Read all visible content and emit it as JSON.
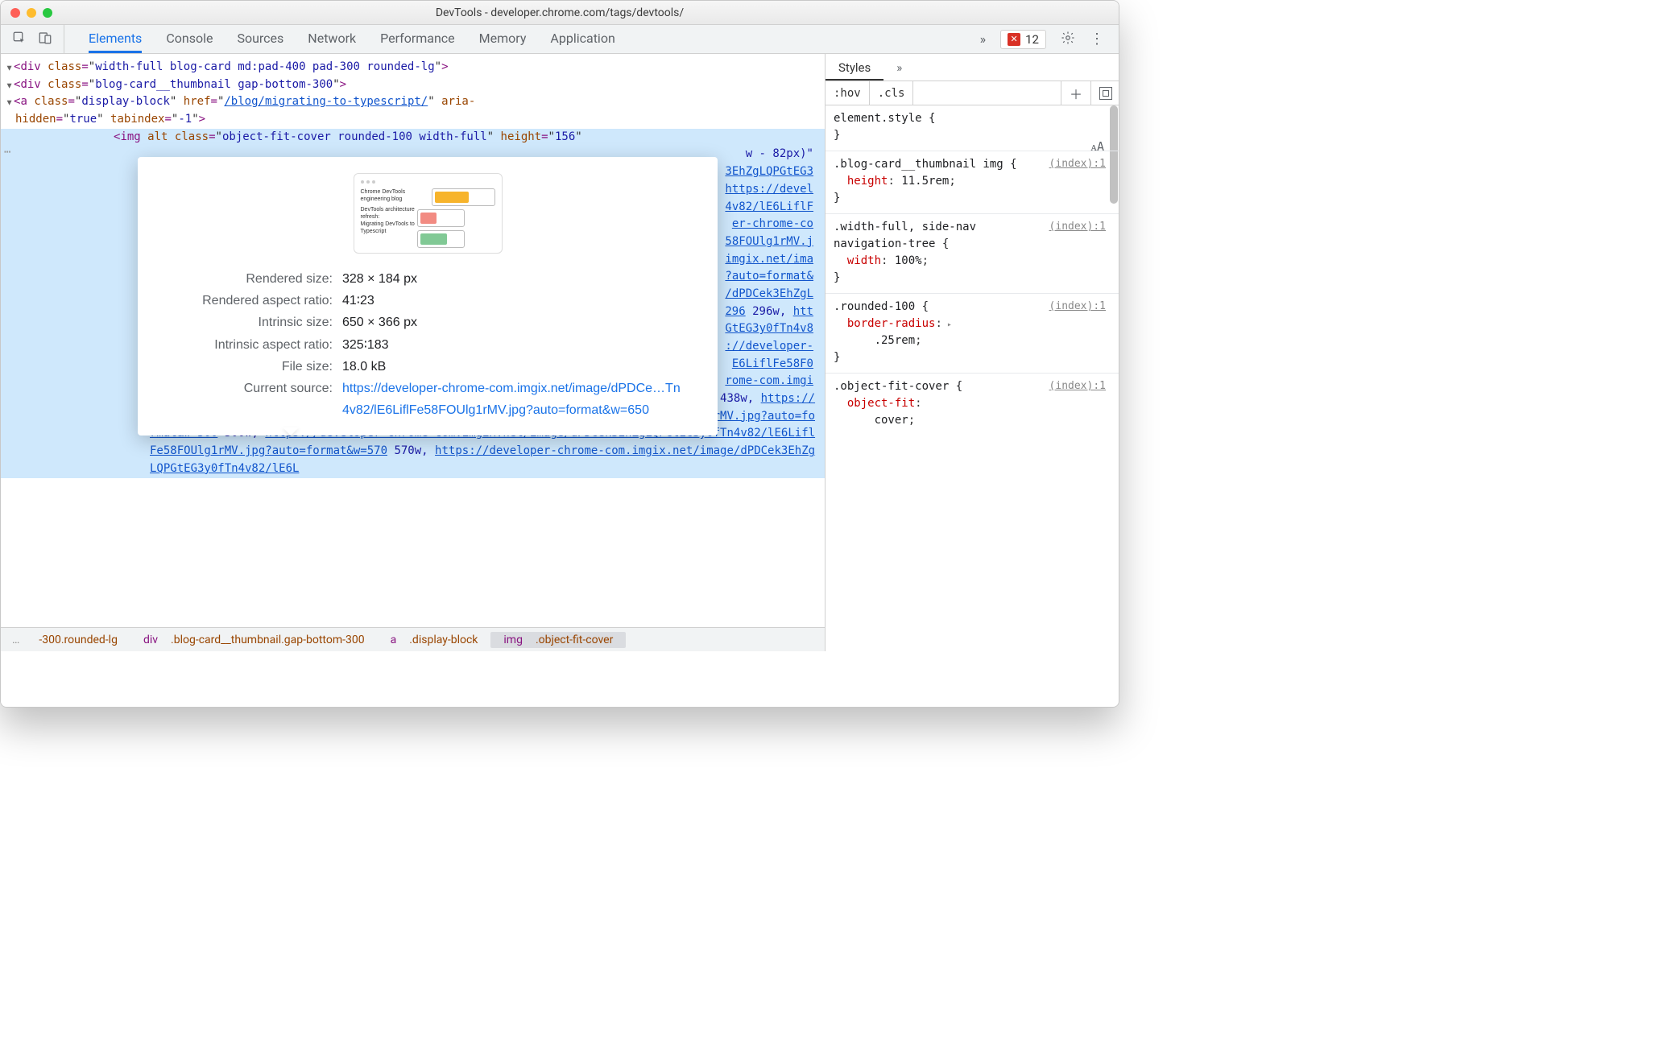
{
  "window": {
    "title": "DevTools - developer.chrome.com/tags/devtools/"
  },
  "toolbar": {
    "tabs": [
      "Elements",
      "Console",
      "Sources",
      "Network",
      "Performance",
      "Memory",
      "Application"
    ],
    "active_tab": "Elements",
    "errors": "12"
  },
  "elements": {
    "line1_class": "width-full blog-card md:pad-400 pad-300 rounded-lg",
    "line2_class": "blog-card__thumbnail gap-bottom-300",
    "line3_class": "display-block",
    "line3_href": "/blog/migrating-to-typescript/",
    "line3_aria": "true",
    "line3_tab": "-1",
    "img_class": "object-fit-cover rounded-100 width-full",
    "img_height": "156",
    "frag_w82": "w - 82px)\"",
    "frag_hash": "3EhZgLQPGtEG3",
    "frag_https": "https://devel",
    "frag_4v82": "4v82/lE6LiflF",
    "frag_chrome": "er-chrome-co",
    "frag_58": "58FOUlg1rMV.j",
    "frag_imgix": "imgix.net/ima",
    "frag_auto": "?auto=format&",
    "frag_dpd": "/dPDCek3EhZgL",
    "frag_296a": "296",
    "frag_296b": "296w,",
    "frag_htt": "htt",
    "frag_gtes": "GtEG3y0fTn4v8",
    "frag_devel": "://developer-",
    "frag_e6": "E6LiflFe58F0",
    "frag_rome": "rome-com.imgi",
    "linktail": "x.net/image/dPDCek3EhZgLQPGtEG3y0fTn4v82/lE6LiflFe58FOUlg1rMV.jpg?auto=format&w=438",
    "w438": "438w,",
    "link500": "https://developer-chrome-com.imgix.net/image/dPDCek3EhZgLQPGtEG3y0fTn4v82/lE6LiflFe58FOUlg1rMV.jpg?auto=format&w=500",
    "w500": "500w,",
    "link570": "https://developer-chrome-com.imgix.net/image/dPDCek3EhZgLQPGtEG3y0fTn4v82/lE6LiflFe58FOUlg1rMV.jpg?auto=format&w=570",
    "w570": "570w,",
    "linklast": "https://developer-chrome-com.imgix.net/image/dPDCek3EhZgLQPGtEG3y0fTn4v82/lE6L"
  },
  "popover": {
    "thumb_title": "Chrome DevTools engineering blog",
    "thumb_sub1": "DevTools architecture refresh:",
    "thumb_sub2": "Migrating DevTools to Typescript",
    "rows": [
      {
        "label": "Rendered size:",
        "value": "328 × 184 px"
      },
      {
        "label": "Rendered aspect ratio:",
        "value": "41∶23"
      },
      {
        "label": "Intrinsic size:",
        "value": "650 × 366 px"
      },
      {
        "label": "Intrinsic aspect ratio:",
        "value": "325∶183"
      },
      {
        "label": "File size:",
        "value": "18.0 kB"
      }
    ],
    "source_label": "Current source:",
    "source_url": "https://developer-chrome-com.imgix.net/image/dPDCe…Tn4v82/lE6LiflFe58FOUlg1rMV.jpg?auto=format&w=650"
  },
  "crumbs": {
    "a": "-300.rounded-lg",
    "b_el": "div",
    "b_cls": ".blog-card__thumbnail.gap-bottom-300",
    "c_el": "a",
    "c_cls": ".display-block",
    "d_el": "img",
    "d_cls": ".object-fit-cover"
  },
  "styles": {
    "tab": "Styles",
    "hov": ":hov",
    "cls": ".cls",
    "r1_sel": "element.style",
    "r2_sel": ".blog-card__thumbnail img",
    "r2_src": "(index):1",
    "r2_p": "height",
    "r2_v": "11.5rem",
    "r3_sel": ".width-full, side-nav navigation-tree",
    "r3_src": "(index):1",
    "r3_p": "width",
    "r3_v": "100%",
    "r4_sel": ".rounded-100",
    "r4_src": "(index):1",
    "r4_p": "border-radius",
    "r4_v": ".25rem",
    "r5_sel": ".object-fit-cover",
    "r5_src": "(index):1",
    "r5_p": "object-fit",
    "r5_v": "cover"
  }
}
